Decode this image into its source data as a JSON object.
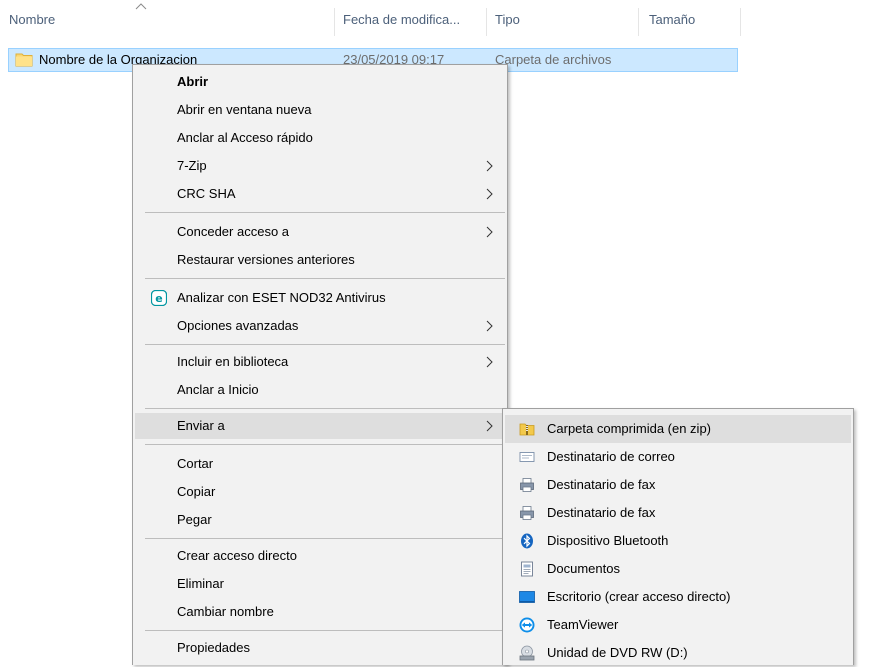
{
  "columns": {
    "name": "Nombre",
    "date": "Fecha de modifica...",
    "type": "Tipo",
    "size": "Tamaño"
  },
  "file": {
    "name": "Nombre de la Organizacion",
    "date": "23/05/2019 09:17",
    "type": "Carpeta de archivos"
  },
  "menu": {
    "open": "Abrir",
    "open_new_window": "Abrir en ventana nueva",
    "pin_quick_access": "Anclar al Acceso rápido",
    "seven_zip": "7-Zip",
    "crc_sha": "CRC SHA",
    "grant_access": "Conceder acceso a",
    "restore_versions": "Restaurar versiones anteriores",
    "scan_eset": "Analizar con ESET NOD32 Antivirus",
    "advanced_options": "Opciones avanzadas",
    "include_library": "Incluir en biblioteca",
    "pin_start": "Anclar a Inicio",
    "send_to": "Enviar a",
    "cut": "Cortar",
    "copy": "Copiar",
    "paste": "Pegar",
    "create_shortcut": "Crear acceso directo",
    "delete": "Eliminar",
    "rename": "Cambiar nombre",
    "properties": "Propiedades"
  },
  "submenu": {
    "zip": "Carpeta comprimida (en zip)",
    "mail": "Destinatario de correo",
    "fax1": "Destinatario de fax",
    "fax2": "Destinatario de fax",
    "bluetooth": "Dispositivo Bluetooth",
    "documents": "Documentos",
    "desktop": "Escritorio (crear acceso directo)",
    "teamviewer": "TeamViewer",
    "dvd": "Unidad de DVD RW (D:)"
  },
  "colors": {
    "selection": "#cce8ff",
    "selection_border": "#99d1ff",
    "menu_bg": "#f2f2f2",
    "menu_highlight": "#dedede",
    "header_text": "#4c607a"
  }
}
